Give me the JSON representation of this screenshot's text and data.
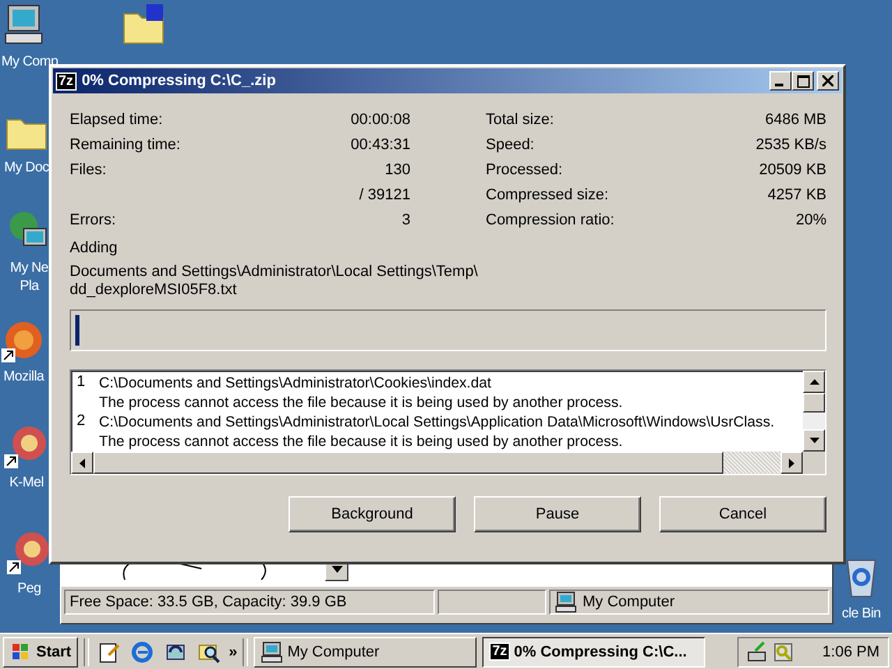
{
  "desktop_icons": [
    {
      "kind": "computer",
      "label": "My Comp"
    },
    {
      "kind": "folder"
    },
    {
      "kind": "documents",
      "label": "My Doc"
    },
    {
      "kind": "network",
      "label": "My Ne\nPla"
    },
    {
      "kind": "browser",
      "label": "Mozilla"
    },
    {
      "kind": "app",
      "label": "K-Mel"
    },
    {
      "kind": "app",
      "label": "Peg"
    },
    {
      "kind": "recycle",
      "label": "cle Bin"
    }
  ],
  "background_window": {
    "status_text": "Free Space: 33.5 GB, Capacity: 39.9 GB",
    "location": "My Computer"
  },
  "dialog": {
    "app_badge": "7z",
    "title": "0% Compressing C:\\C_.zip",
    "stats_left": [
      {
        "label": "Elapsed time:",
        "value": "00:00:08"
      },
      {
        "label": "Remaining time:",
        "value": "00:43:31"
      },
      {
        "label": "Files:",
        "value": "130"
      },
      {
        "value": "/ 39121"
      },
      {
        "label": "Errors:",
        "value": "3"
      }
    ],
    "stats_right": [
      {
        "label": "Total size:",
        "value": "6486 MB"
      },
      {
        "label": "Speed:",
        "value": "2535 KB/s"
      },
      {
        "label": "Processed:",
        "value": "20509 KB"
      },
      {
        "label": "Compressed size:",
        "value": "4257 KB"
      },
      {
        "label": "Compression ratio:",
        "value": "20%"
      }
    ],
    "action": "Adding",
    "current_file": "Documents and Settings\\Administrator\\Local Settings\\Temp\\ dd_dexploreMSI05F8.txt",
    "progress": {
      "level": 0.005
    },
    "log": [
      {
        "number": "1",
        "path": "C:\\Documents and Settings\\Administrator\\Cookies\\index.dat",
        "message": "The process cannot access the file because it is being used by another process."
      },
      {
        "number": "2",
        "path": "C:\\Documents and Settings\\Administrator\\Local Settings\\Application Data\\Microsoft\\Windows\\UsrClass.",
        "message": "The process cannot access the file because it is being used by another process."
      }
    ],
    "buttons": [
      "Background",
      "Pause",
      "Cancel"
    ]
  },
  "taskbar": {
    "start": "Start",
    "more": "»",
    "tasks": [
      {
        "kind": "computer",
        "label": "My Computer",
        "selected": false
      },
      {
        "kind": "7z",
        "label": "0% Compressing C:\\C...",
        "selected": true
      }
    ],
    "clock": "1:06 PM"
  }
}
